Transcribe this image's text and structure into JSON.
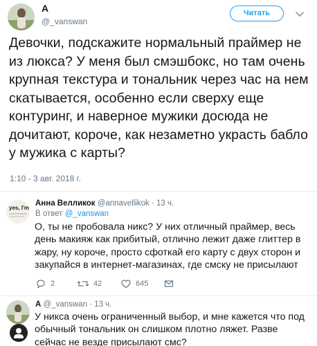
{
  "main_tweet": {
    "author_name": "A",
    "author_handle": "@_vanswan",
    "follow_button": "Читать",
    "text": "Девочки, подскажите нормальный праймер не из люкса? У меня был смэшбокс,  но там очень крупная текстура и тональник через час на нем скатывается,  особенно если сверху еще контуринг, и наверное мужики досюда не дочитают, короче, как незаметно украсть бабло у мужика с карты?",
    "timestamp": "1:10 - 3 авг. 2018 г."
  },
  "reply_1": {
    "author_name": "Анна Велликок",
    "meta": "@annavellikok · 13 ч.",
    "reply_to_prefix": "В ответ",
    "reply_to_handle": "@_vanswan",
    "text": "О, ты не пробовала никс? У них отличный праймер, весь день макияж как прибитый, отлично лежит даже глиттер в жару, ну короче, просто сфоткай его карту с двух сторон и закупайся в интернет-магазинах, где смску не присылают",
    "avatar_text": "yes, I'm drunk",
    "actions": {
      "reply_count": "2",
      "retweet_count": "42",
      "like_count": "645"
    }
  },
  "reply_2": {
    "author_name": "A",
    "meta": "@_vanswan · 13 ч.",
    "text": "У никса очень ограниченный выбор, и мне кажется что под обычный тональник он слишком плотно ляжет. Разве сейчас не везде присылают смс?"
  },
  "colors": {
    "accent": "#1da1f2",
    "link": "#1b95e0",
    "muted": "#657786",
    "text": "#14171a",
    "separator": "#e6ecf0"
  }
}
